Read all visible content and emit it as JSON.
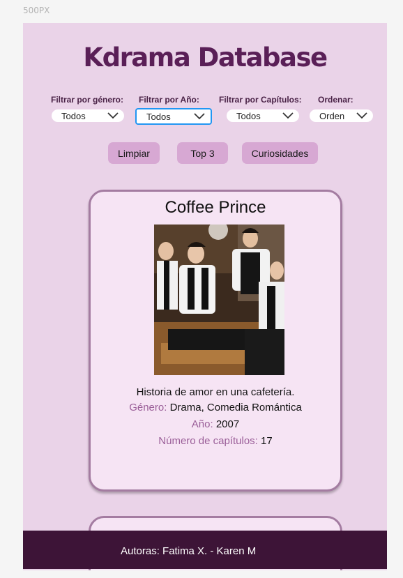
{
  "frame_label": "500PX",
  "title": "Kdrama Database",
  "filters": [
    {
      "label": "Filtrar por género:",
      "value": "Todos"
    },
    {
      "label": "Filtrar por Año:",
      "value": "Todos"
    },
    {
      "label": "Filtrar por Capítulos:",
      "value": "Todos"
    },
    {
      "label": "Ordenar:",
      "value": "Orden"
    }
  ],
  "buttons": {
    "clear": "Limpiar",
    "top": "Top 3",
    "curiosities": "Curiosidades"
  },
  "card": {
    "title": "Coffee Prince",
    "description": "Historia de amor en una cafetería.",
    "genre_key": "Género:",
    "genre": "Drama, Comedia Romántica",
    "year_key": "Año:",
    "year": "2007",
    "episodes_key": "Número de capítulos:",
    "episodes": "17"
  },
  "footer": "Autoras: Fatima X. - Karen M",
  "colors": {
    "background": "#ead3e8",
    "title": "#5a1f57",
    "button": "#d7a8d3",
    "footer": "#3d1437",
    "accent_key": "#9a5e98"
  }
}
